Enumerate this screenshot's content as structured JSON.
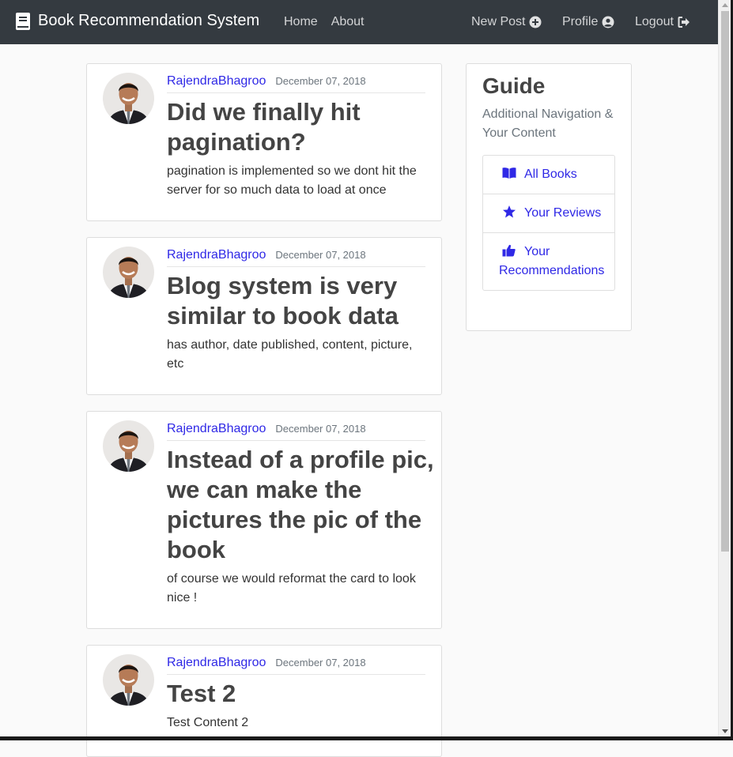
{
  "navbar": {
    "brand": "Book Recommendation System",
    "brand_icon": "book-icon",
    "left_links": [
      "Home",
      "About"
    ],
    "right_links": [
      {
        "label": "New Post",
        "icon": "plus-circle-icon"
      },
      {
        "label": "Profile",
        "icon": "user-circle-icon"
      },
      {
        "label": "Logout",
        "icon": "sign-out-icon"
      }
    ]
  },
  "posts": [
    {
      "author": "RajendraBhagroo",
      "date": "December 07, 2018",
      "title": "Did we finally hit pagination?",
      "content": "pagination is implemented so we dont hit the server for so much data to load at once"
    },
    {
      "author": "RajendraBhagroo",
      "date": "December 07, 2018",
      "title": "Blog system is very similar to book data",
      "content": "has author, date published, content, picture, etc"
    },
    {
      "author": "RajendraBhagroo",
      "date": "December 07, 2018",
      "title": "Instead of a profile pic, we can make the pictures the pic of the book",
      "content": "of course we would reformat the card to look nice !"
    },
    {
      "author": "RajendraBhagroo",
      "date": "December 07, 2018",
      "title": "Test 2",
      "content": "Test Content 2"
    }
  ],
  "guide": {
    "title": "Guide",
    "subtitle": "Additional Navigation & Your Content",
    "items": [
      {
        "label": "All Books",
        "icon": "open-book-icon"
      },
      {
        "label": "Your Reviews",
        "icon": "star-icon"
      },
      {
        "label": "Your Recommendations",
        "icon": "thumbs-up-icon"
      }
    ]
  },
  "colors": {
    "navbar_bg": "#343a40",
    "link": "#2f28e6",
    "page_bg": "#fafafa"
  }
}
